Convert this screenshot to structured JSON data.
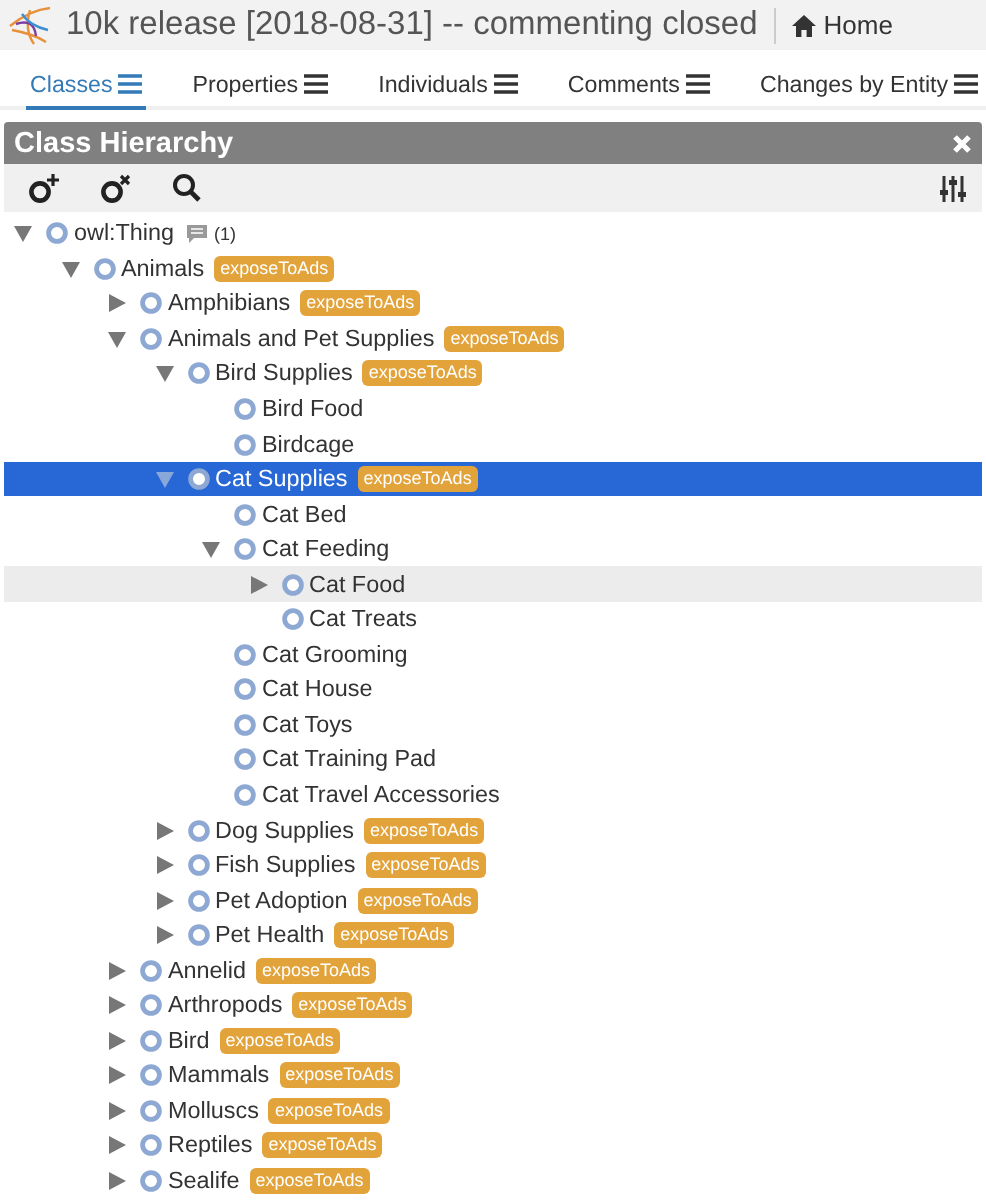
{
  "header": {
    "title": "10k release [2018-08-31] -- commenting closed",
    "home_link": "Home"
  },
  "tabs": [
    {
      "label": "Classes",
      "selected": true
    },
    {
      "label": "Properties",
      "selected": false
    },
    {
      "label": "Individuals",
      "selected": false
    },
    {
      "label": "Comments",
      "selected": false
    },
    {
      "label": "Changes by Entity",
      "selected": false
    }
  ],
  "panel": {
    "title": "Class Hierarchy",
    "tree": [
      {
        "label": "owl:Thing",
        "comment_count": "(1)",
        "expanded": true,
        "selected": false,
        "hovered": false,
        "children": [
          {
            "label": "Animals",
            "tag": "exposeToAds",
            "expanded": true,
            "selected": false,
            "hovered": false,
            "children": [
              {
                "label": "Amphibians",
                "tag": "exposeToAds",
                "expanded": false,
                "selected": false,
                "hovered": false
              },
              {
                "label": "Animals and Pet Supplies",
                "tag": "exposeToAds",
                "expanded": true,
                "selected": false,
                "hovered": false,
                "children": [
                  {
                    "label": "Bird Supplies",
                    "tag": "exposeToAds",
                    "expanded": true,
                    "selected": false,
                    "hovered": false,
                    "children": [
                      {
                        "label": "Bird Food",
                        "selected": false,
                        "hovered": false
                      },
                      {
                        "label": "Birdcage",
                        "selected": false,
                        "hovered": false
                      }
                    ]
                  },
                  {
                    "label": "Cat Supplies",
                    "tag": "exposeToAds",
                    "expanded": true,
                    "selected": true,
                    "hovered": false,
                    "children": [
                      {
                        "label": "Cat Bed",
                        "selected": false,
                        "hovered": false
                      },
                      {
                        "label": "Cat Feeding",
                        "expanded": true,
                        "selected": false,
                        "hovered": false,
                        "children": [
                          {
                            "label": "Cat Food",
                            "expanded": false,
                            "selected": false,
                            "hovered": true
                          },
                          {
                            "label": "Cat Treats",
                            "selected": false,
                            "hovered": false
                          }
                        ]
                      },
                      {
                        "label": "Cat Grooming",
                        "selected": false,
                        "hovered": false
                      },
                      {
                        "label": "Cat House",
                        "selected": false,
                        "hovered": false
                      },
                      {
                        "label": "Cat Toys",
                        "selected": false,
                        "hovered": false
                      },
                      {
                        "label": "Cat Training Pad",
                        "selected": false,
                        "hovered": false
                      },
                      {
                        "label": "Cat Travel Accessories",
                        "selected": false,
                        "hovered": false
                      }
                    ]
                  },
                  {
                    "label": "Dog Supplies",
                    "tag": "exposeToAds",
                    "expanded": false,
                    "selected": false,
                    "hovered": false
                  },
                  {
                    "label": "Fish Supplies",
                    "tag": "exposeToAds",
                    "expanded": false,
                    "selected": false,
                    "hovered": false
                  },
                  {
                    "label": "Pet Adoption",
                    "tag": "exposeToAds",
                    "expanded": false,
                    "selected": false,
                    "hovered": false
                  },
                  {
                    "label": "Pet Health",
                    "tag": "exposeToAds",
                    "expanded": false,
                    "selected": false,
                    "hovered": false
                  }
                ]
              },
              {
                "label": "Annelid",
                "tag": "exposeToAds",
                "expanded": false,
                "selected": false,
                "hovered": false
              },
              {
                "label": "Arthropods",
                "tag": "exposeToAds",
                "expanded": false,
                "selected": false,
                "hovered": false
              },
              {
                "label": "Bird",
                "tag": "exposeToAds",
                "expanded": false,
                "selected": false,
                "hovered": false
              },
              {
                "label": "Mammals",
                "tag": "exposeToAds",
                "expanded": false,
                "selected": false,
                "hovered": false
              },
              {
                "label": "Molluscs",
                "tag": "exposeToAds",
                "expanded": false,
                "selected": false,
                "hovered": false
              },
              {
                "label": "Reptiles",
                "tag": "exposeToAds",
                "expanded": false,
                "selected": false,
                "hovered": false
              },
              {
                "label": "Sealife",
                "tag": "exposeToAds",
                "expanded": false,
                "selected": false,
                "hovered": false
              }
            ]
          }
        ]
      }
    ]
  }
}
